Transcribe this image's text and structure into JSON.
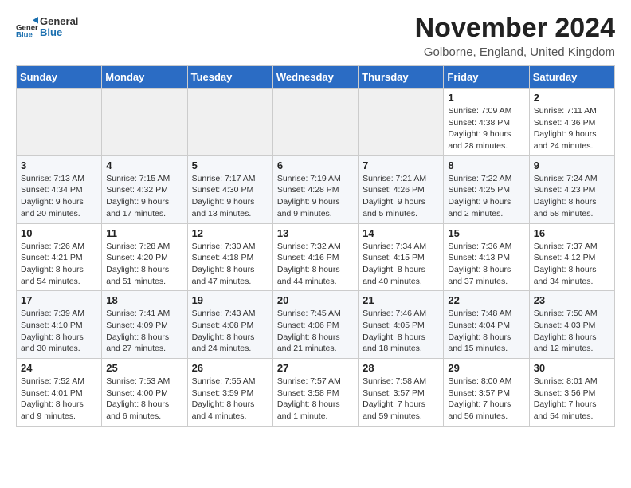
{
  "logo": {
    "general": "General",
    "blue": "Blue"
  },
  "header": {
    "title": "November 2024",
    "subtitle": "Golborne, England, United Kingdom"
  },
  "days_of_week": [
    "Sunday",
    "Monday",
    "Tuesday",
    "Wednesday",
    "Thursday",
    "Friday",
    "Saturday"
  ],
  "weeks": [
    [
      {
        "day": "",
        "info": ""
      },
      {
        "day": "",
        "info": ""
      },
      {
        "day": "",
        "info": ""
      },
      {
        "day": "",
        "info": ""
      },
      {
        "day": "",
        "info": ""
      },
      {
        "day": "1",
        "info": "Sunrise: 7:09 AM\nSunset: 4:38 PM\nDaylight: 9 hours\nand 28 minutes."
      },
      {
        "day": "2",
        "info": "Sunrise: 7:11 AM\nSunset: 4:36 PM\nDaylight: 9 hours\nand 24 minutes."
      }
    ],
    [
      {
        "day": "3",
        "info": "Sunrise: 7:13 AM\nSunset: 4:34 PM\nDaylight: 9 hours\nand 20 minutes."
      },
      {
        "day": "4",
        "info": "Sunrise: 7:15 AM\nSunset: 4:32 PM\nDaylight: 9 hours\nand 17 minutes."
      },
      {
        "day": "5",
        "info": "Sunrise: 7:17 AM\nSunset: 4:30 PM\nDaylight: 9 hours\nand 13 minutes."
      },
      {
        "day": "6",
        "info": "Sunrise: 7:19 AM\nSunset: 4:28 PM\nDaylight: 9 hours\nand 9 minutes."
      },
      {
        "day": "7",
        "info": "Sunrise: 7:21 AM\nSunset: 4:26 PM\nDaylight: 9 hours\nand 5 minutes."
      },
      {
        "day": "8",
        "info": "Sunrise: 7:22 AM\nSunset: 4:25 PM\nDaylight: 9 hours\nand 2 minutes."
      },
      {
        "day": "9",
        "info": "Sunrise: 7:24 AM\nSunset: 4:23 PM\nDaylight: 8 hours\nand 58 minutes."
      }
    ],
    [
      {
        "day": "10",
        "info": "Sunrise: 7:26 AM\nSunset: 4:21 PM\nDaylight: 8 hours\nand 54 minutes."
      },
      {
        "day": "11",
        "info": "Sunrise: 7:28 AM\nSunset: 4:20 PM\nDaylight: 8 hours\nand 51 minutes."
      },
      {
        "day": "12",
        "info": "Sunrise: 7:30 AM\nSunset: 4:18 PM\nDaylight: 8 hours\nand 47 minutes."
      },
      {
        "day": "13",
        "info": "Sunrise: 7:32 AM\nSunset: 4:16 PM\nDaylight: 8 hours\nand 44 minutes."
      },
      {
        "day": "14",
        "info": "Sunrise: 7:34 AM\nSunset: 4:15 PM\nDaylight: 8 hours\nand 40 minutes."
      },
      {
        "day": "15",
        "info": "Sunrise: 7:36 AM\nSunset: 4:13 PM\nDaylight: 8 hours\nand 37 minutes."
      },
      {
        "day": "16",
        "info": "Sunrise: 7:37 AM\nSunset: 4:12 PM\nDaylight: 8 hours\nand 34 minutes."
      }
    ],
    [
      {
        "day": "17",
        "info": "Sunrise: 7:39 AM\nSunset: 4:10 PM\nDaylight: 8 hours\nand 30 minutes."
      },
      {
        "day": "18",
        "info": "Sunrise: 7:41 AM\nSunset: 4:09 PM\nDaylight: 8 hours\nand 27 minutes."
      },
      {
        "day": "19",
        "info": "Sunrise: 7:43 AM\nSunset: 4:08 PM\nDaylight: 8 hours\nand 24 minutes."
      },
      {
        "day": "20",
        "info": "Sunrise: 7:45 AM\nSunset: 4:06 PM\nDaylight: 8 hours\nand 21 minutes."
      },
      {
        "day": "21",
        "info": "Sunrise: 7:46 AM\nSunset: 4:05 PM\nDaylight: 8 hours\nand 18 minutes."
      },
      {
        "day": "22",
        "info": "Sunrise: 7:48 AM\nSunset: 4:04 PM\nDaylight: 8 hours\nand 15 minutes."
      },
      {
        "day": "23",
        "info": "Sunrise: 7:50 AM\nSunset: 4:03 PM\nDaylight: 8 hours\nand 12 minutes."
      }
    ],
    [
      {
        "day": "24",
        "info": "Sunrise: 7:52 AM\nSunset: 4:01 PM\nDaylight: 8 hours\nand 9 minutes."
      },
      {
        "day": "25",
        "info": "Sunrise: 7:53 AM\nSunset: 4:00 PM\nDaylight: 8 hours\nand 6 minutes."
      },
      {
        "day": "26",
        "info": "Sunrise: 7:55 AM\nSunset: 3:59 PM\nDaylight: 8 hours\nand 4 minutes."
      },
      {
        "day": "27",
        "info": "Sunrise: 7:57 AM\nSunset: 3:58 PM\nDaylight: 8 hours\nand 1 minute."
      },
      {
        "day": "28",
        "info": "Sunrise: 7:58 AM\nSunset: 3:57 PM\nDaylight: 7 hours\nand 59 minutes."
      },
      {
        "day": "29",
        "info": "Sunrise: 8:00 AM\nSunset: 3:57 PM\nDaylight: 7 hours\nand 56 minutes."
      },
      {
        "day": "30",
        "info": "Sunrise: 8:01 AM\nSunset: 3:56 PM\nDaylight: 7 hours\nand 54 minutes."
      }
    ]
  ]
}
